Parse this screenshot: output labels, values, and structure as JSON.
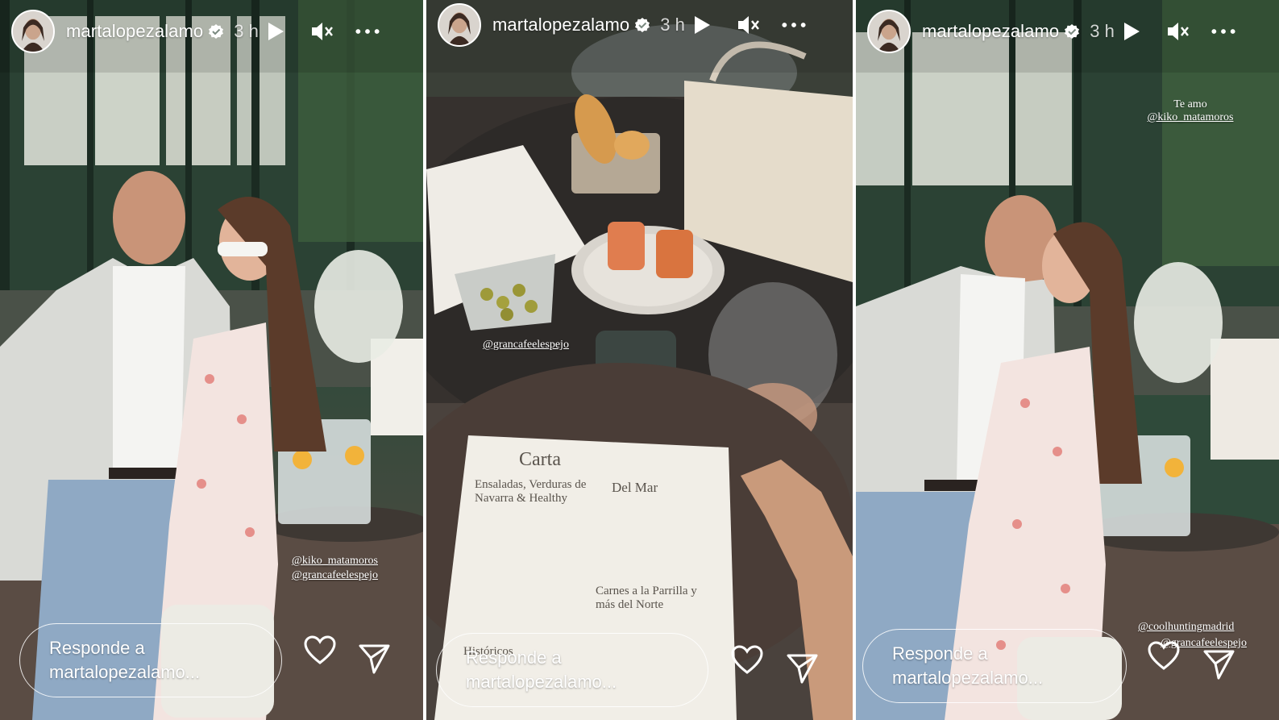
{
  "stories": [
    {
      "username": "martalopezalamo",
      "time": "3 h",
      "mentions": [
        "@kiko_matamoros",
        "@grancafeelespejo"
      ],
      "reply_placeholder_line1": "Responde a",
      "reply_placeholder_line2": "martalopezalamo..."
    },
    {
      "username": "martalopezalamo",
      "time": "3 h",
      "mentions": [
        "@grancafeelespejo"
      ],
      "menu": {
        "title": "Carta",
        "section_1": "Ensaladas, Verduras de Navarra & Healthy",
        "section_2": "Del Mar",
        "section_3": "Carnes a la Parrilla y más del Norte",
        "section_4": "Históricos"
      },
      "reply_placeholder_line1": "Responde a",
      "reply_placeholder_line2": "martalopezalamo..."
    },
    {
      "username": "martalopezalamo",
      "time": "3 h",
      "caption_line1": "Te amo",
      "caption_line2": "@kiko_matamoros",
      "mentions": [
        "@coolhuntingmadrid",
        "@grancafeelespejo"
      ],
      "reply_placeholder_line1": "Responde a",
      "reply_placeholder_line2": "martalopezalamo..."
    }
  ],
  "icons": {
    "verified": "verified-badge-icon",
    "play": "play-icon",
    "mute": "muted-speaker-icon",
    "more": "more-options-icon",
    "like": "heart-icon",
    "share": "send-icon"
  },
  "colors": {
    "verified": "#ffffff",
    "text": "#ffffff"
  }
}
